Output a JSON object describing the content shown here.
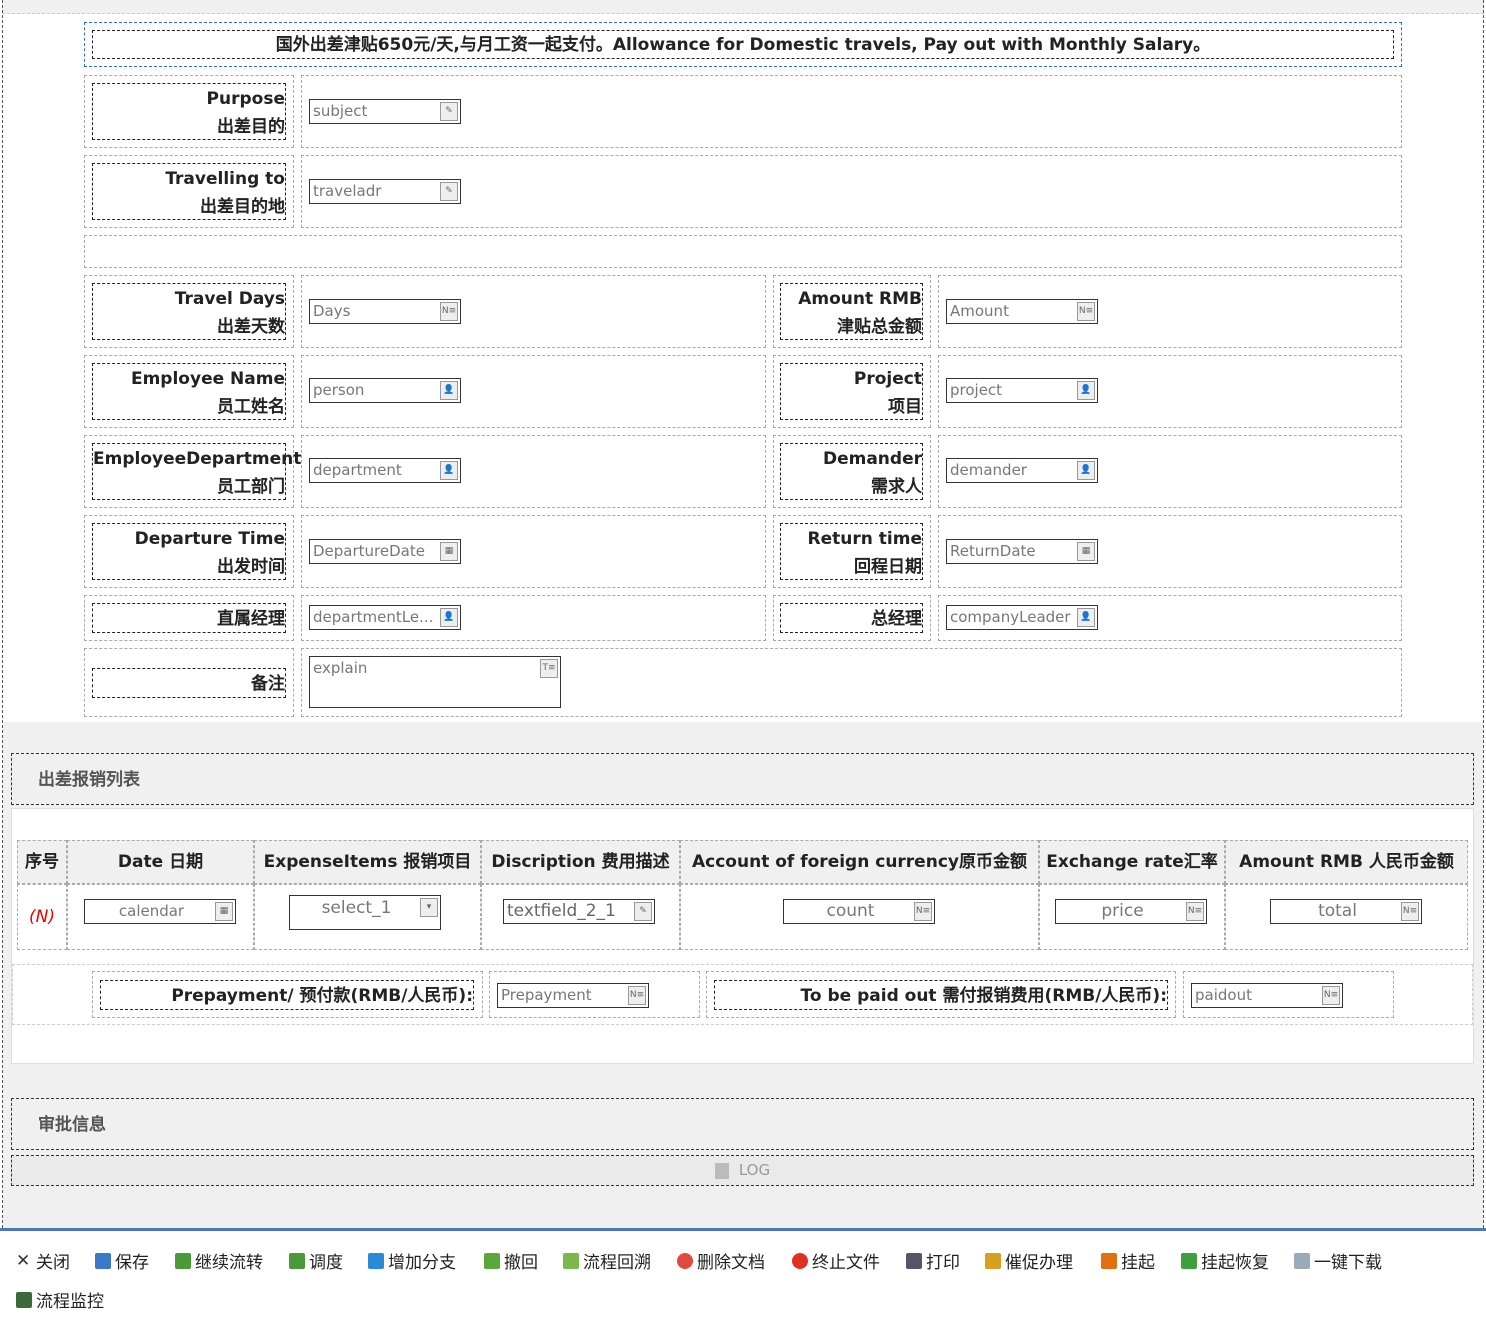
{
  "form": {
    "notice": "国外出差津贴650元/天,与月工资一起支付。Allowance for Domestic travels, Pay out with Monthly Salary。",
    "purpose": {
      "en": "Purpose",
      "cn": "出差目的",
      "value": "subject"
    },
    "travel": {
      "en": "Travelling to",
      "cn": "出差目的地",
      "value": "traveladr"
    },
    "days": {
      "en": "Travel Days",
      "cn": "出差天数",
      "value": "Days"
    },
    "amount": {
      "en": "Amount RMB",
      "cn": "津贴总金额",
      "value": "Amount"
    },
    "employee": {
      "en": "Employee Name",
      "cn": "员工姓名",
      "value": "person"
    },
    "project": {
      "en": "Project",
      "cn": "项目",
      "value": "project"
    },
    "department": {
      "en": "EmployeeDepartment",
      "cn": "员工部门",
      "value": "department"
    },
    "demander": {
      "en": "Demander",
      "cn": "需求人",
      "value": "demander"
    },
    "departure": {
      "en": "Departure Time",
      "cn": "出发时间",
      "value": "DepartureDate"
    },
    "return": {
      "en": "Return time",
      "cn": "回程日期",
      "value": "ReturnDate"
    },
    "manager": {
      "cn": "直属经理",
      "value": "departmentLe..."
    },
    "gm": {
      "cn": "总经理",
      "value": "companyLeader"
    },
    "remark": {
      "cn": "备注",
      "value": "explain"
    }
  },
  "expense": {
    "title": "出差报销列表",
    "headers": [
      "序号",
      "Date 日期",
      "ExpenseItems 报销项目",
      "Discription 费用描述",
      "Account of foreign currency原币金额",
      "Exchange rate汇率",
      "Amount RMB 人民币金额"
    ],
    "row": {
      "index": "(N)",
      "date": "calendar",
      "item": "select_1",
      "desc": "textfield_2_1",
      "count": "count",
      "price": "price",
      "total": "total"
    },
    "prepay_label": "Prepayment/ 预付款(RMB/人民币):",
    "prepay_value": "Prepayment",
    "paidout_label": "To be paid out 需付报销费用(RMB/人民币):",
    "paidout_value": "paidout"
  },
  "approval": {
    "title": "审批信息",
    "log": "LOG"
  },
  "toolbar": [
    {
      "label": "关闭",
      "icon": "close-icon",
      "color": "#333"
    },
    {
      "label": "保存",
      "icon": "save-icon",
      "color": "#3a78c8"
    },
    {
      "label": "继续流转",
      "icon": "forward-icon",
      "color": "#4a9a3a"
    },
    {
      "label": "调度",
      "icon": "dispatch-icon",
      "color": "#4a9a3a"
    },
    {
      "label": "增加分支",
      "icon": "branch-icon",
      "color": "#2a8ad8"
    },
    {
      "label": "撤回",
      "icon": "undo-icon",
      "color": "#5aa83a"
    },
    {
      "label": "流程回溯",
      "icon": "trace-icon",
      "color": "#7ab84a"
    },
    {
      "label": "删除文档",
      "icon": "delete-icon",
      "color": "#e04a3a"
    },
    {
      "label": "终止文件",
      "icon": "stop-icon",
      "color": "#e03020"
    },
    {
      "label": "打印",
      "icon": "print-icon",
      "color": "#556"
    },
    {
      "label": "催促办理",
      "icon": "urge-icon",
      "color": "#d8a020"
    },
    {
      "label": "挂起",
      "icon": "suspend-icon",
      "color": "#e07010"
    },
    {
      "label": "挂起恢复",
      "icon": "resume-icon",
      "color": "#40a040"
    },
    {
      "label": "一键下载",
      "icon": "download-icon",
      "color": "#9ab"
    },
    {
      "label": "流程监控",
      "icon": "monitor-icon",
      "color": "#3a6a3a"
    }
  ]
}
